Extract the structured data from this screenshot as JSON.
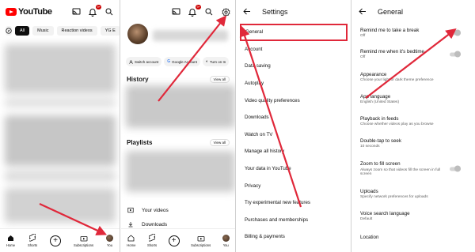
{
  "panel1": {
    "logo_text": "YouTube",
    "notif_count": "9+",
    "chips": [
      "All",
      "Music",
      "Reaction videos",
      "YG E"
    ],
    "nav": [
      "Home",
      "Shorts",
      "",
      "Subscriptions",
      "You"
    ]
  },
  "panel2": {
    "notif_count": "9+",
    "account_chips": [
      "Switch account",
      "Google Account",
      "Turn on In"
    ],
    "history_title": "History",
    "history_view_all": "View all",
    "playlists_title": "Playlists",
    "playlists_view_all": "View all",
    "items": [
      "Your videos",
      "Downloads"
    ],
    "nav": [
      "Home",
      "Shorts",
      "",
      "Subscriptions",
      "You"
    ]
  },
  "panel3": {
    "title": "Settings",
    "items": [
      "General",
      "Account",
      "Data saving",
      "Autoplay",
      "Video quality preferences",
      "Downloads",
      "Watch on TV",
      "Manage all history",
      "Your data in YouTube",
      "Privacy",
      "Try experimental new features",
      "Purchases and memberships",
      "Billing & payments"
    ]
  },
  "panel4": {
    "title": "General",
    "items": [
      {
        "title": "Remind me to take a break",
        "sub": "Off"
      },
      {
        "title": "Remind me when it's bedtime",
        "sub": "Off"
      },
      {
        "title": "Appearance",
        "sub": "Choose your light or dark theme preference"
      },
      {
        "title": "App language",
        "sub": "English (United States)"
      },
      {
        "title": "Playback in feeds",
        "sub": "Choose whether videos play as you browse"
      },
      {
        "title": "Double-tap to seek",
        "sub": "10 seconds"
      },
      {
        "title": "Zoom to fill screen",
        "sub": "Always zoom so that videos fill the screen in full screen"
      },
      {
        "title": "Uploads",
        "sub": "Specify network preferences for uploads"
      },
      {
        "title": "Voice search language",
        "sub": "Default"
      },
      {
        "title": "Location",
        "sub": ""
      }
    ]
  },
  "colors": {
    "accent_red": "#e0283a",
    "youtube_red": "#ff0000"
  }
}
